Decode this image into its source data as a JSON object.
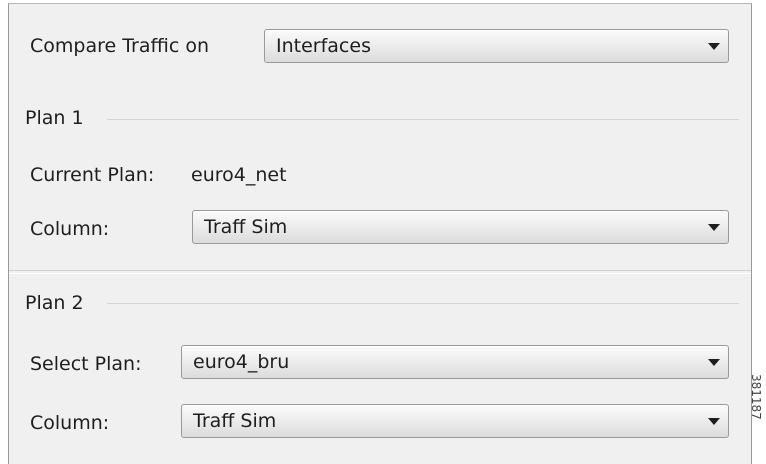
{
  "compare": {
    "label": "Compare Traffic on",
    "selected": "Interfaces"
  },
  "plan1": {
    "title": "Plan 1",
    "current_plan_label": "Current Plan:",
    "current_plan_value": "euro4_net",
    "column_label": "Column:",
    "column_selected": "Traff Sim"
  },
  "plan2": {
    "title": "Plan 2",
    "select_plan_label": "Select Plan:",
    "select_plan_selected": "euro4_bru",
    "column_label": "Column:",
    "column_selected": "Traff Sim"
  },
  "icons": {
    "dropdown_arrow": "chevron-down-icon"
  },
  "figure_id": "381187"
}
